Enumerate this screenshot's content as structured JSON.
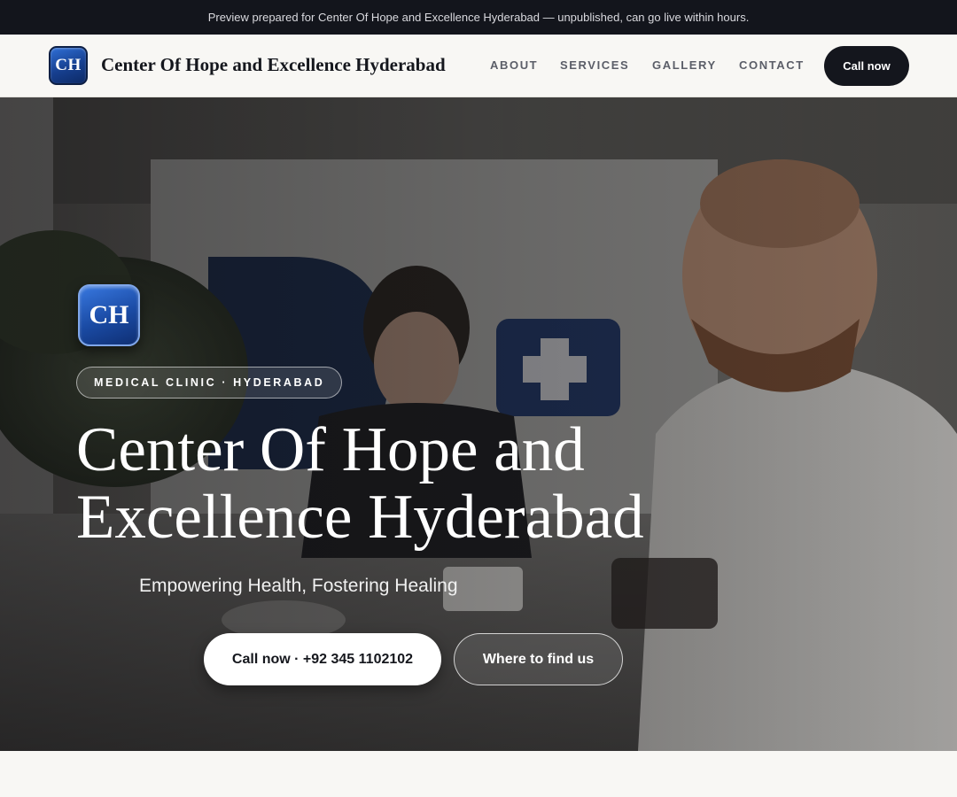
{
  "banner": {
    "text": "Preview prepared for Center Of Hope and Excellence Hyderabad — unpublished, can go live within hours."
  },
  "nav": {
    "logo_text": "CH",
    "title": "Center Of Hope and Excellence Hyderabad",
    "links": [
      "ABOUT",
      "SERVICES",
      "GALLERY",
      "CONTACT"
    ],
    "cta_label": "Call now"
  },
  "hero": {
    "logo_text": "CH",
    "badge": "MEDICAL CLINIC · HYDERABAD",
    "title": "Center Of Hope and Excellence Hyderabad",
    "tagline": "Empowering Health, Fostering Healing",
    "primary_button": "Call now · +92 345 1102102",
    "secondary_button": "Where to find us"
  },
  "colors": {
    "dark": "#14161d",
    "brand_blue": "#1a4aa3",
    "page_bg": "#f8f7f4"
  }
}
